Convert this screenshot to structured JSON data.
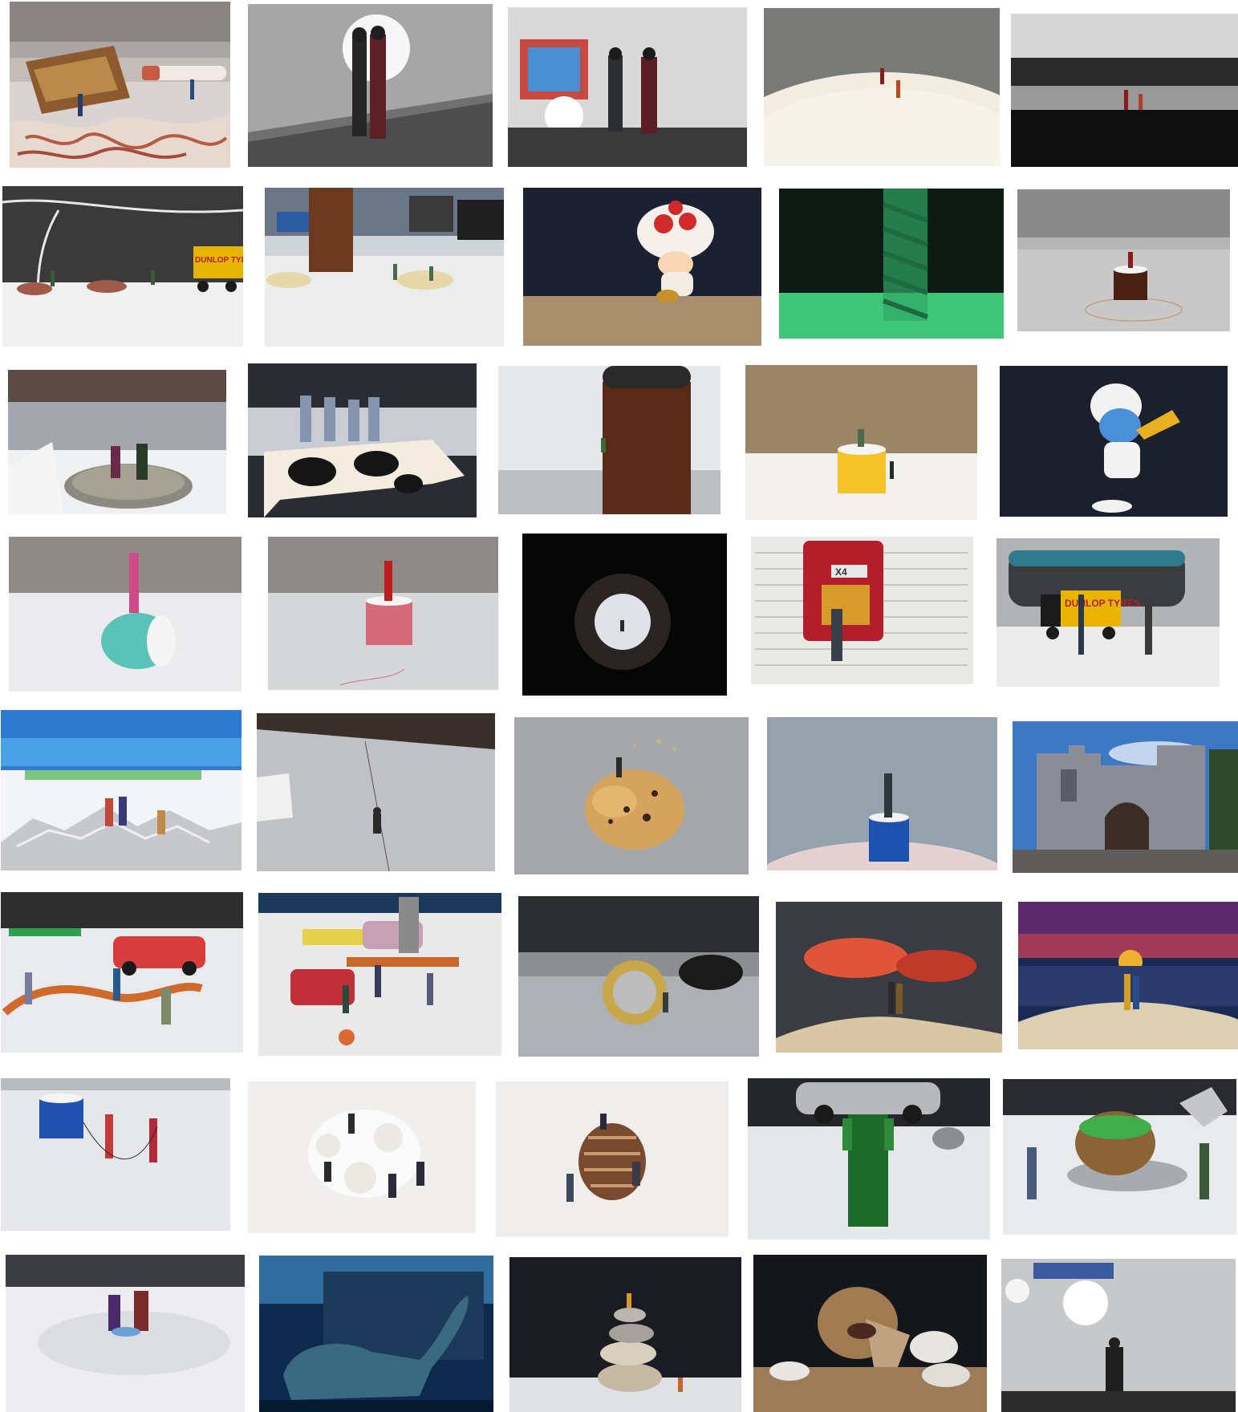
{
  "gallery": {
    "photo_count": 40,
    "columns": 5,
    "rows": 8,
    "photos": [
      {
        "subject": "miniature figures around crumbling cake on paper"
      },
      {
        "subject": "two figures standing on rail against light"
      },
      {
        "subject": "two figures viewing a painting"
      },
      {
        "subject": "two tiny figures on top of white dome"
      },
      {
        "subject": "two figures on dark horizon edge"
      },
      {
        "subject": "workers beside road with Dunlop truck"
      },
      {
        "subject": "figures among crumbs and brown bottle"
      },
      {
        "subject": "Toad mushroom toy"
      },
      {
        "subject": "spiral green tape measure"
      },
      {
        "subject": "figure on brown thread spool"
      },
      {
        "subject": "couple sitting on tin can"
      },
      {
        "subject": "group of figures on cow toy"
      },
      {
        "subject": "climber on brown bottle"
      },
      {
        "subject": "figure on yellow thread spool"
      },
      {
        "subject": "Smurf playing trumpet"
      },
      {
        "subject": "figure on teal thread spool"
      },
      {
        "subject": "figure on pink thread spool"
      },
      {
        "subject": "figure seen through tube"
      },
      {
        "subject": "figure in front of red toy car on newspaper"
      },
      {
        "subject": "figures beside Dunlop truck"
      },
      {
        "subject": "figures on foil mountain"
      },
      {
        "subject": "figure abseiling on string"
      },
      {
        "subject": "figure on muffin"
      },
      {
        "subject": "figure on blue thread spool"
      },
      {
        "subject": "castle gatehouse picture"
      },
      {
        "subject": "figures with toy cars and orange band"
      },
      {
        "subject": "figures with crashed toy cars"
      },
      {
        "subject": "figure pushing pound coin"
      },
      {
        "subject": "couple on sand with blurred red background"
      },
      {
        "subject": "couple on sand at sunset"
      },
      {
        "subject": "figures skipping with blue thread"
      },
      {
        "subject": "figures climbing white coral"
      },
      {
        "subject": "figures on pine cone"
      },
      {
        "subject": "green robot lifting car"
      },
      {
        "subject": "figures with kiwi fruit on foil"
      },
      {
        "subject": "couple sitting on small blue object"
      },
      {
        "subject": "dinosaur toy in blue forest"
      },
      {
        "subject": "figures on stacked stones"
      },
      {
        "subject": "lion toy between rocks"
      },
      {
        "subject": "single figure sitting on ledge"
      }
    ]
  },
  "visible_text": {
    "dunlop_truck_1": "DUNLOP TYRES",
    "dunlop_truck_2": "DUNLOP TYRES",
    "toy_car_plate": "X4"
  },
  "palette": {
    "background": "#ffffff"
  }
}
